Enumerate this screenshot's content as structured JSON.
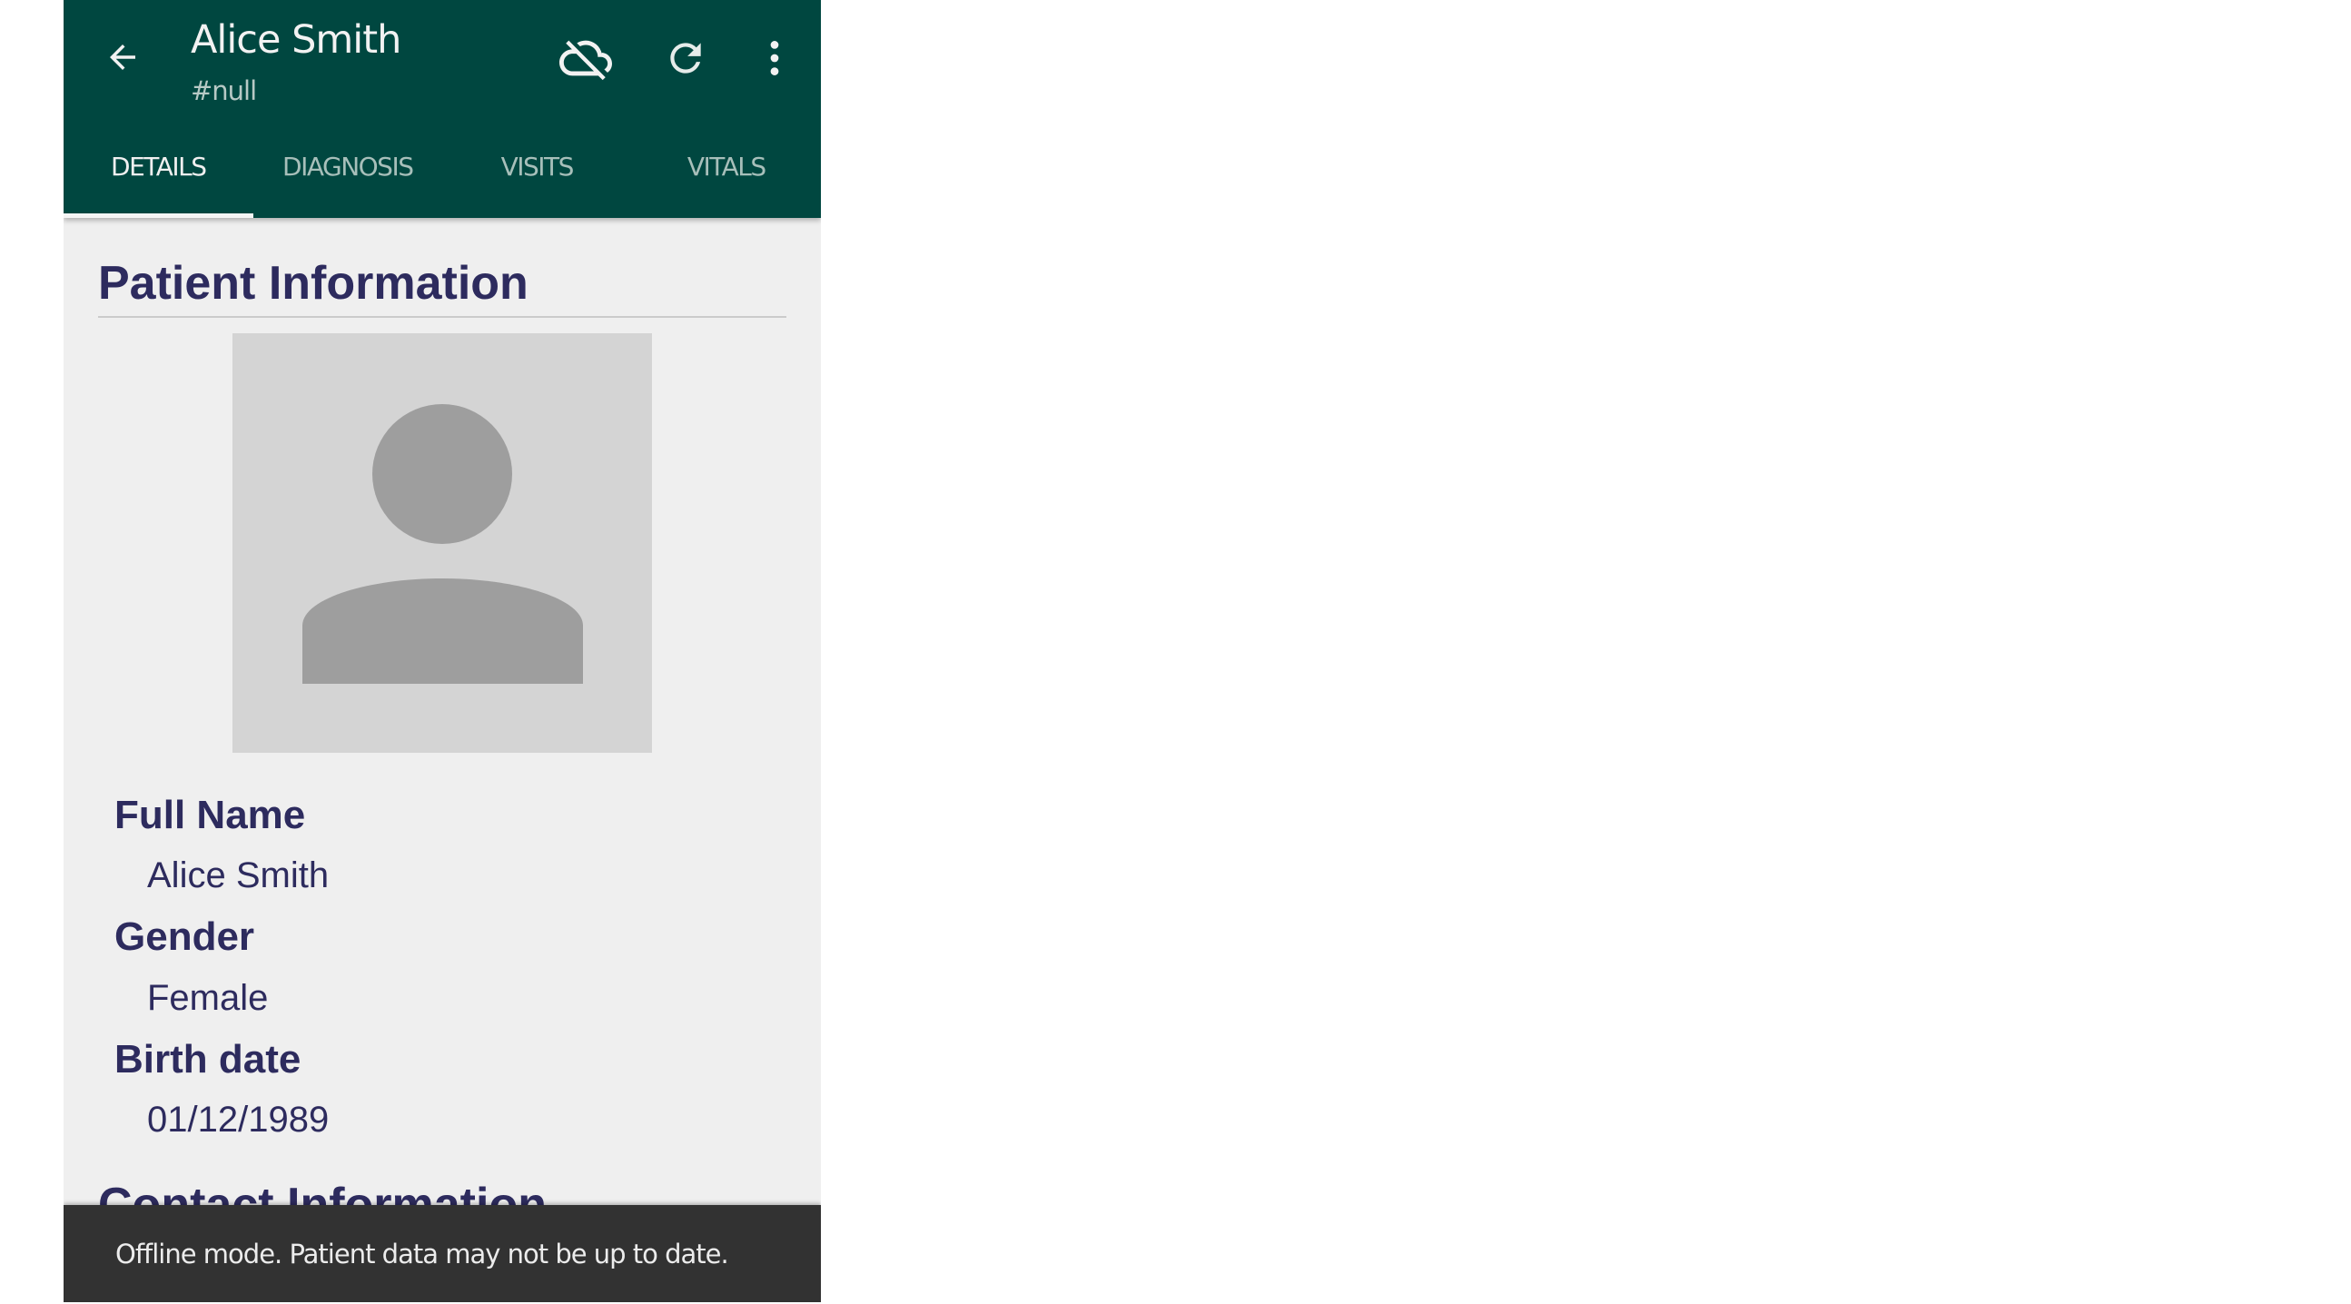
{
  "appbar": {
    "title": "Alice Smith",
    "subtitle": "#null",
    "icons": {
      "back": "arrow-back",
      "sync_status": "cloud-off",
      "refresh": "refresh",
      "more": "more-vertical"
    },
    "colors": {
      "background": "#004740",
      "title": "#f2f2f2",
      "subtitle": "#b7c9c5"
    }
  },
  "tabs": [
    {
      "label": "DETAILS",
      "active": true
    },
    {
      "label": "DIAGNOSIS",
      "active": false
    },
    {
      "label": "VISITS",
      "active": false
    },
    {
      "label": "VITALS",
      "active": false
    }
  ],
  "patient_information": {
    "heading": "Patient Information",
    "avatar": "default-person-placeholder",
    "fields": [
      {
        "label": "Full Name",
        "value": "Alice Smith"
      },
      {
        "label": "Gender",
        "value": "Female"
      },
      {
        "label": "Birth date",
        "value": "01/12/1989"
      }
    ]
  },
  "contact_information": {
    "heading": "Contact Information"
  },
  "snackbar": {
    "message": "Offline mode. Patient data may not be up to date.",
    "background": "#323232"
  },
  "colors": {
    "content_background": "#efefef",
    "heading_text": "#2d2b5e",
    "avatar_background": "#d4d4d4",
    "avatar_figure": "#9e9e9e"
  }
}
